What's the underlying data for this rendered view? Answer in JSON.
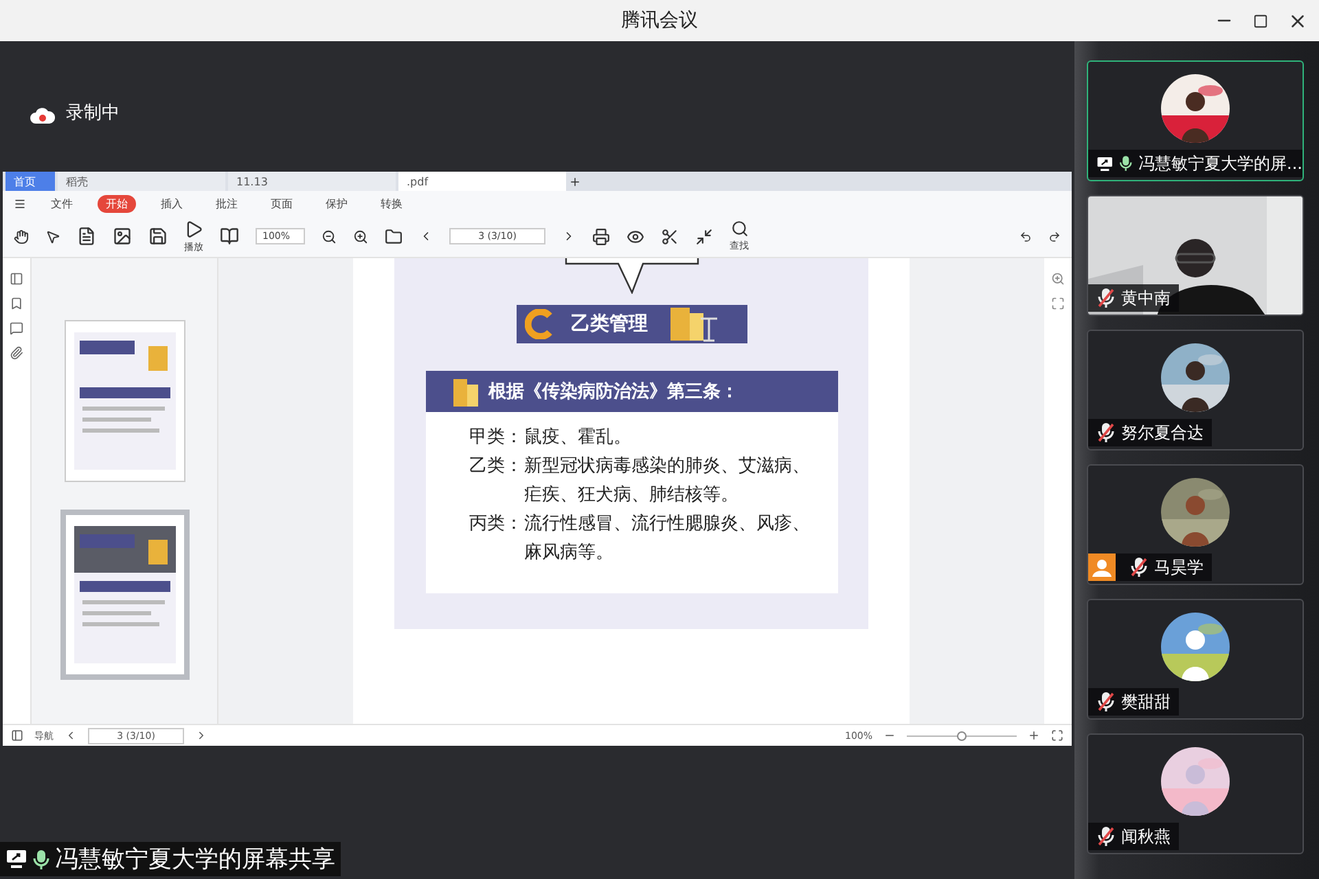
{
  "window": {
    "title": "腾讯会议"
  },
  "recording": {
    "label": "录制中"
  },
  "viewer": {
    "tabs": [
      {
        "label": "首页",
        "kind": "home",
        "selected": false
      },
      {
        "label": "稻壳",
        "kind": "doc",
        "selected": false
      },
      {
        "label": "11.13",
        "kind": "doc",
        "selected": false
      },
      {
        "label": ".pdf",
        "kind": "doc",
        "selected": true
      }
    ],
    "menu": [
      {
        "label": "文件",
        "selected": false
      },
      {
        "label": "开始",
        "selected": true
      },
      {
        "label": "插入",
        "selected": false
      },
      {
        "label": "批注",
        "selected": false
      },
      {
        "label": "页面",
        "selected": false
      },
      {
        "label": "保护",
        "selected": false
      },
      {
        "label": "转换",
        "selected": false
      }
    ],
    "zoom": "100%",
    "page": "3 (3/10)",
    "tools": [
      {
        "label": "播放"
      },
      {
        "label": "查找"
      }
    ],
    "thumbnails": [
      {
        "selected": false
      },
      {
        "selected": true
      }
    ],
    "document": {
      "section": "乙类管理",
      "heading": "根据《传染病防治法》第三条：",
      "lines": [
        {
          "label": "甲类：",
          "text": "鼠疫、霍乱。"
        },
        {
          "label": "乙类：",
          "text": "新型冠状病毒感染的肺炎、艾滋病、疟疾、狂犬病、肺结核等。"
        },
        {
          "label": "丙类：",
          "text": "流行性感冒、流行性腮腺炎、风疹、麻风病等。"
        }
      ]
    },
    "status": {
      "nav": "导航",
      "page": "3 (3/10)",
      "zoom": "100%"
    }
  },
  "share_caption": "冯慧敏宁夏大学的屏幕共享",
  "participants": [
    {
      "name": "冯慧敏宁夏大学的屏...",
      "selected": true,
      "muted": false,
      "sharing": true,
      "host_badge": false,
      "kind": "avatar"
    },
    {
      "name": "黄中南",
      "selected": false,
      "muted": true,
      "sharing": false,
      "host_badge": false,
      "kind": "video"
    },
    {
      "name": "努尔夏合达",
      "selected": false,
      "muted": true,
      "sharing": false,
      "host_badge": false,
      "kind": "avatar"
    },
    {
      "name": "马昊学",
      "selected": false,
      "muted": true,
      "sharing": false,
      "host_badge": true,
      "kind": "avatar"
    },
    {
      "name": "樊甜甜",
      "selected": false,
      "muted": true,
      "sharing": false,
      "host_badge": false,
      "kind": "avatar"
    },
    {
      "name": "闻秋燕",
      "selected": false,
      "muted": true,
      "sharing": false,
      "host_badge": false,
      "kind": "avatar"
    }
  ]
}
